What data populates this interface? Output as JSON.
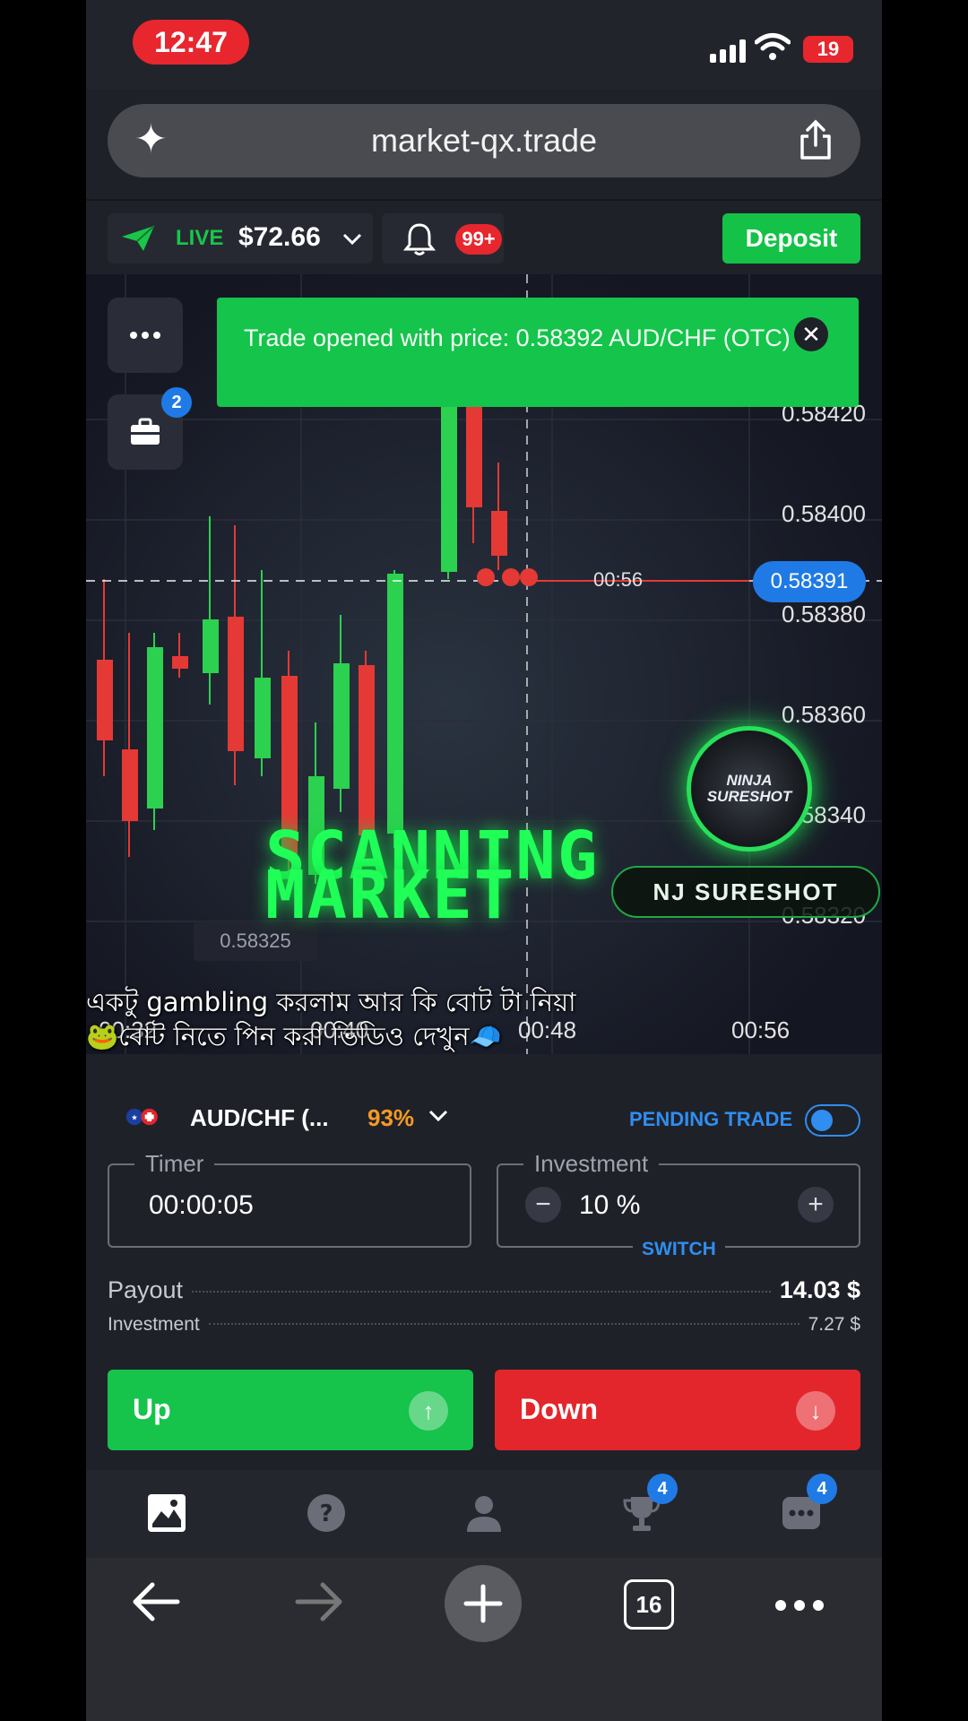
{
  "status": {
    "time": "12:47",
    "battery": "19"
  },
  "browser": {
    "url": "market-qx.trade",
    "tab_count": "16"
  },
  "header": {
    "account_mode": "LIVE",
    "balance": "$72.66",
    "notification_badge": "99+",
    "deposit_label": "Deposit"
  },
  "chart": {
    "portfolio_badge": "2",
    "toast_message": "Trade opened with price: 0.58392 AUD/CHF (OTC)",
    "current_price": "0.58391",
    "countdown": "00:56",
    "y_labels": [
      "0.58420",
      "0.58400",
      "0.58380",
      "0.58360",
      "0.58340",
      "0.58320"
    ],
    "low_marker": "0.58325",
    "x_labels": [
      "00:32",
      "00:40",
      "00:48",
      "00:56"
    ],
    "overlay_title_1": "SCANNING",
    "overlay_title_2": "MARKET",
    "logo_text": "NINJA SURESHOT",
    "brand_tag": "NJ SURESHOT",
    "caption_line_1": "একটু gambling করলাম আর কি বোট টা নিয়া",
    "caption_line_2": "🐸বোট নিতে পিন করা ভিডিও দেখুন🧢"
  },
  "trade": {
    "pair": "AUD/CHF (...",
    "payout_percent": "93%",
    "pending_trade_label": "PENDING TRADE",
    "timer_label": "Timer",
    "timer_value": "00:00:05",
    "investment_label": "Investment",
    "investment_value": "10 %",
    "switch_label": "SWITCH",
    "payout_label": "Payout",
    "payout_value": "14.03 $",
    "investment_row_label": "Investment",
    "investment_row_value": "7.27 $",
    "up_label": "Up",
    "down_label": "Down"
  },
  "tabbar": {
    "trophy_badge": "4",
    "more_badge": "4"
  },
  "colors": {
    "green": "#16c34b",
    "red": "#e3262c",
    "blue": "#1f7ae6",
    "orange": "#f59a23"
  }
}
